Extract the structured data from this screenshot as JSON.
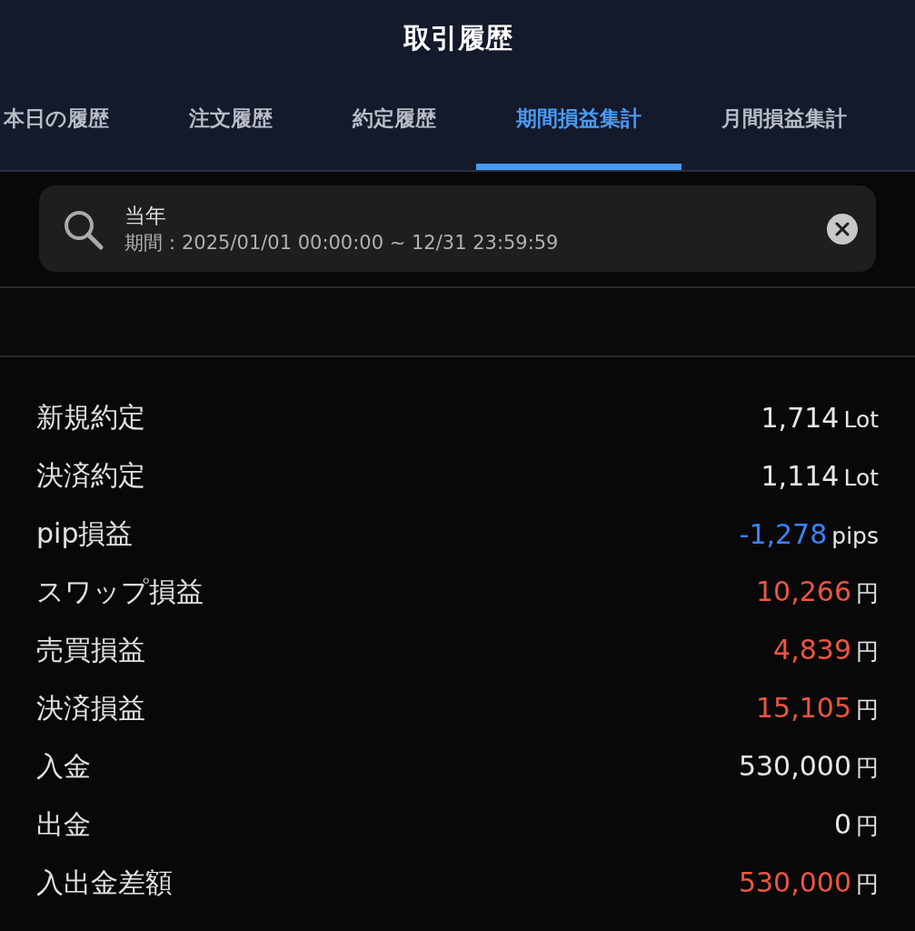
{
  "header": {
    "title": "取引履歴"
  },
  "tabs": [
    {
      "label": "本日の履歴",
      "selected": false
    },
    {
      "label": "注文履歴",
      "selected": false
    },
    {
      "label": "約定履歴",
      "selected": false
    },
    {
      "label": "期間損益集計",
      "selected": true
    },
    {
      "label": "月間損益集計",
      "selected": false
    }
  ],
  "search": {
    "title": "当年",
    "period": "期間：2025/01/01 00:00:00 ~ 12/31 23:59:59"
  },
  "rows": [
    {
      "label": "新規約定",
      "value": "1,714",
      "unit": "Lot",
      "color": "#e6e6e6"
    },
    {
      "label": "決済約定",
      "value": "1,114",
      "unit": "Lot",
      "color": "#e6e6e6"
    },
    {
      "label": "pip損益",
      "value": "-1,278",
      "unit": "pips",
      "color": "#3b82f6"
    },
    {
      "label": "スワップ損益",
      "value": "10,266",
      "unit": "円",
      "color": "#ec5543"
    },
    {
      "label": "売買損益",
      "value": "4,839",
      "unit": "円",
      "color": "#ec5543"
    },
    {
      "label": "決済損益",
      "value": "15,105",
      "unit": "円",
      "color": "#ec5543"
    },
    {
      "label": "入金",
      "value": "530,000",
      "unit": "円",
      "color": "#e6e6e6"
    },
    {
      "label": "出金",
      "value": "0",
      "unit": "円",
      "color": "#e6e6e6"
    },
    {
      "label": "入出金差額",
      "value": "530,000",
      "unit": "円",
      "color": "#ec5543"
    }
  ]
}
